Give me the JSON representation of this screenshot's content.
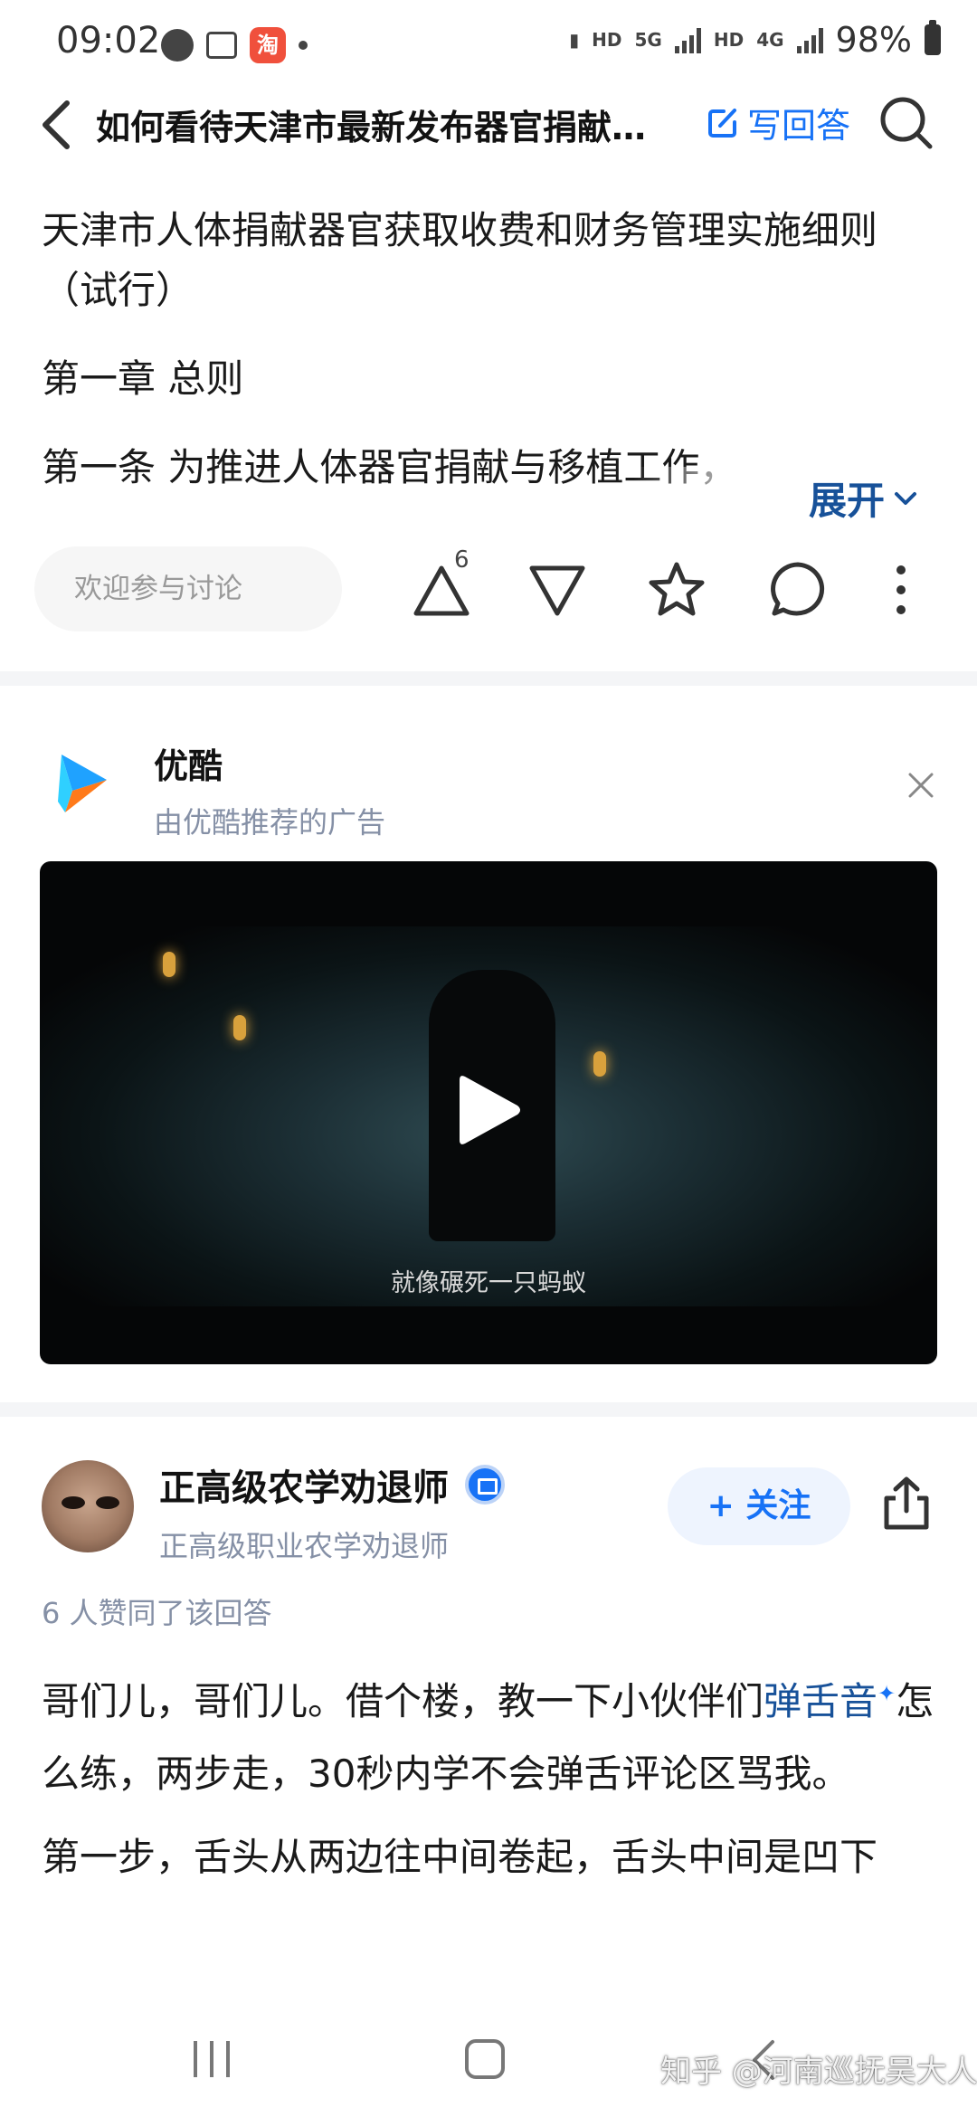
{
  "status_bar": {
    "time": "09:02",
    "hd1": "HD",
    "net1": "5G",
    "hd2": "HD",
    "net2": "4G",
    "battery": "98%"
  },
  "header": {
    "title": "如何看待天津市最新发布器官捐献…",
    "write_label": "写回答"
  },
  "article": {
    "paragraphs": [
      "天津市人体捐献器官获取收费和财务管理实施细则（试行）",
      "第一章 总则",
      "第一条 为推进人体器官捐献与移植工作，"
    ],
    "expand_label": "展开"
  },
  "action_bar": {
    "discuss_placeholder": "欢迎参与讨论",
    "upvote_count": "6"
  },
  "ad": {
    "name": "优酷",
    "subtitle": "由优酷推荐的广告",
    "video_caption": "就像碾死一只蚂蚁"
  },
  "answer": {
    "author": "正高级农学劝退师",
    "author_desc": "正高级职业农学劝退师",
    "follow_label": "+ 关注",
    "likes_text": "6 人赞同了该回答",
    "p1_before": "哥们儿，哥们儿。借个楼，教一下小伙伴们",
    "p1_link": "弹舌音",
    "p1_after": "怎么练，两步走，30秒内学不会弹舌评论区骂我。",
    "p2": "第一步，舌头从两边往中间卷起，舌头中间是凹下"
  },
  "watermark": "知乎 @河南巡抚吴大人",
  "colors": {
    "accent": "#1772f6",
    "link": "#175199",
    "muted": "#8590a6"
  }
}
